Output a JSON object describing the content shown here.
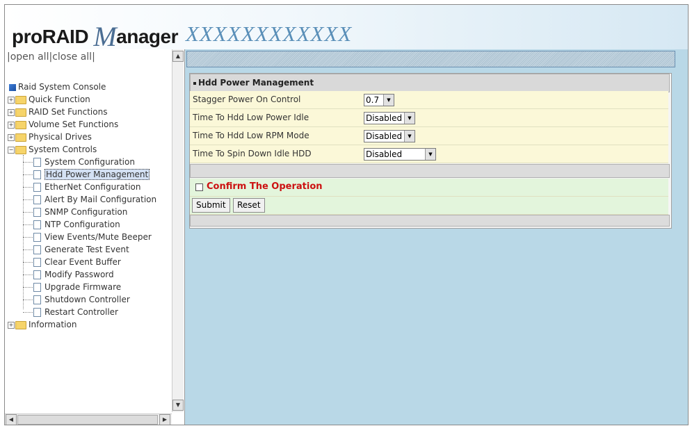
{
  "header": {
    "brand_pre": "proRAID",
    "brand_m": "M",
    "brand_post": "anager",
    "product": "XXXXXXXXXXXX"
  },
  "left": {
    "open_all": "open all",
    "close_all": "close all",
    "sep": "|",
    "tree": {
      "root": "Raid System Console",
      "items": [
        {
          "label": "Quick Function",
          "type": "folder",
          "expanded": false
        },
        {
          "label": "RAID Set Functions",
          "type": "folder",
          "expanded": false
        },
        {
          "label": "Volume Set Functions",
          "type": "folder",
          "expanded": false
        },
        {
          "label": "Physical Drives",
          "type": "folder",
          "expanded": false
        },
        {
          "label": "System Controls",
          "type": "folder",
          "expanded": true
        }
      ],
      "system_controls": [
        "System Configuration",
        "Hdd Power Management",
        "EtherNet Configuration",
        "Alert By Mail Configuration",
        "SNMP Configuration",
        "NTP Configuration",
        "View Events/Mute Beeper",
        "Generate Test Event",
        "Clear Event Buffer",
        "Modify Password",
        "Upgrade Firmware",
        "Shutdown Controller",
        "Restart Controller"
      ],
      "selected": "Hdd Power Management",
      "information": "Information"
    }
  },
  "form": {
    "title": "Hdd Power Management",
    "fields": [
      {
        "label": "Stagger Power On Control",
        "value": "0.7"
      },
      {
        "label": "Time To Hdd Low Power Idle",
        "value": "Disabled"
      },
      {
        "label": "Time To Hdd Low RPM Mode",
        "value": "Disabled"
      },
      {
        "label": "Time To Spin Down Idle HDD",
        "value": "Disabled"
      }
    ],
    "confirm": "Confirm The Operation",
    "submit": "Submit",
    "reset": "Reset"
  },
  "colors": {
    "field_row": "#fbf8d8",
    "confirm_text": "#cc1111",
    "main_bg": "#b9d8e7",
    "button_row": "#e3f5dc"
  }
}
